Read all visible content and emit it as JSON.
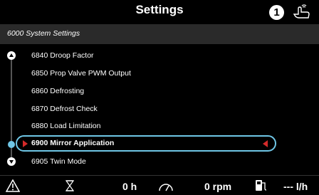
{
  "header": {
    "title": "Settings",
    "info_badge": "1"
  },
  "subheader": {
    "text": "6000 System Settings"
  },
  "menu": {
    "items": [
      {
        "label": "6840 Droop Factor"
      },
      {
        "label": "6850 Prop Valve PWM Output"
      },
      {
        "label": "6860 Defrosting"
      },
      {
        "label": "6870 Defrost Check"
      },
      {
        "label": "6880 Load Limitation"
      },
      {
        "label": "6900 Mirror Application",
        "selected": true
      },
      {
        "label": "6905 Twin Mode"
      }
    ]
  },
  "status": {
    "hours_value": "0 h",
    "rpm_value": "0 rpm",
    "fuel_rate_value": "--- l/h"
  },
  "colors": {
    "accent": "#6fc6e6",
    "selection_arrow": "#d42a2a",
    "subheader_bg": "#2a2a2a"
  },
  "icons": {
    "header": [
      "info-circle-icon",
      "hand-touch-icon"
    ],
    "status": [
      "warning-icon",
      "hourglass-icon",
      "speedometer-icon",
      "fuel-pump-icon"
    ],
    "scroll": [
      "scroll-up-icon",
      "scroll-down-icon"
    ]
  }
}
